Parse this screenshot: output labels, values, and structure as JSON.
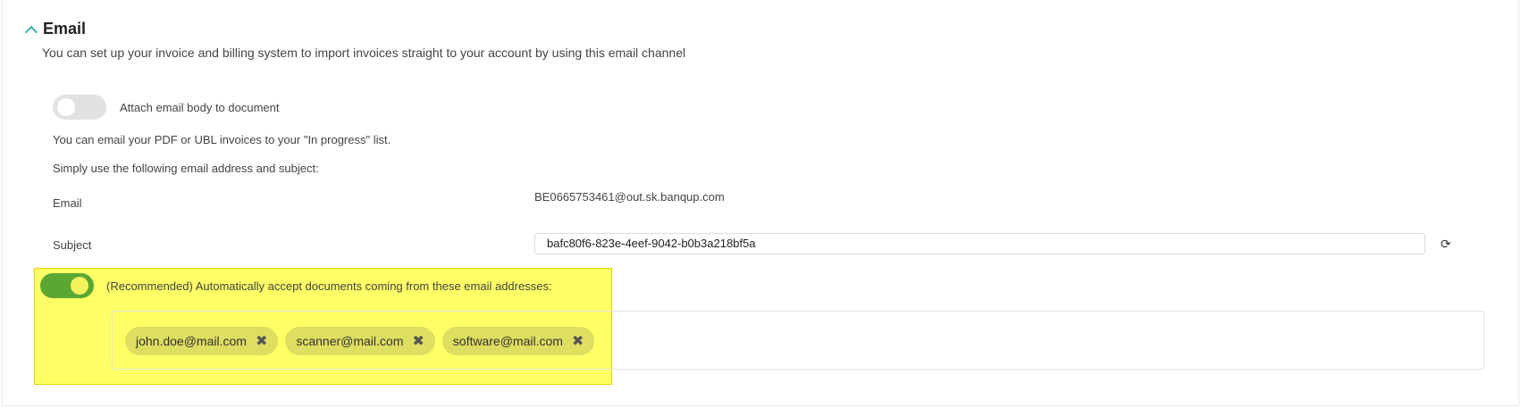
{
  "section": {
    "title": "Email",
    "description": "You can set up your invoice and billing system to import invoices straight to your account by using this email channel"
  },
  "attach_body": {
    "label": "Attach email body to document",
    "enabled": false
  },
  "info": {
    "line1": "You can email your PDF or UBL invoices to your \"In progress\" list.",
    "line2": "Simply use the following email address and subject:"
  },
  "email": {
    "label": "Email",
    "value": "BE0665753461@out.sk.banqup.com"
  },
  "subject": {
    "label": "Subject",
    "value": "bafc80f6-823e-4eef-9042-b0b3a218bf5a"
  },
  "auto_accept": {
    "label": "(Recommended) Automatically accept documents coming from these email addresses:",
    "enabled": true
  },
  "accepted_addresses": [
    "john.doe@mail.com",
    "scanner@mail.com",
    "software@mail.com"
  ],
  "icons": {
    "remove": "✖",
    "refresh": "⟳",
    "collapse": "chevron-up-icon"
  },
  "colors": {
    "toggle_on": "#5aa833",
    "highlight": "#ffff66",
    "chevron": "#3fb4a8"
  }
}
